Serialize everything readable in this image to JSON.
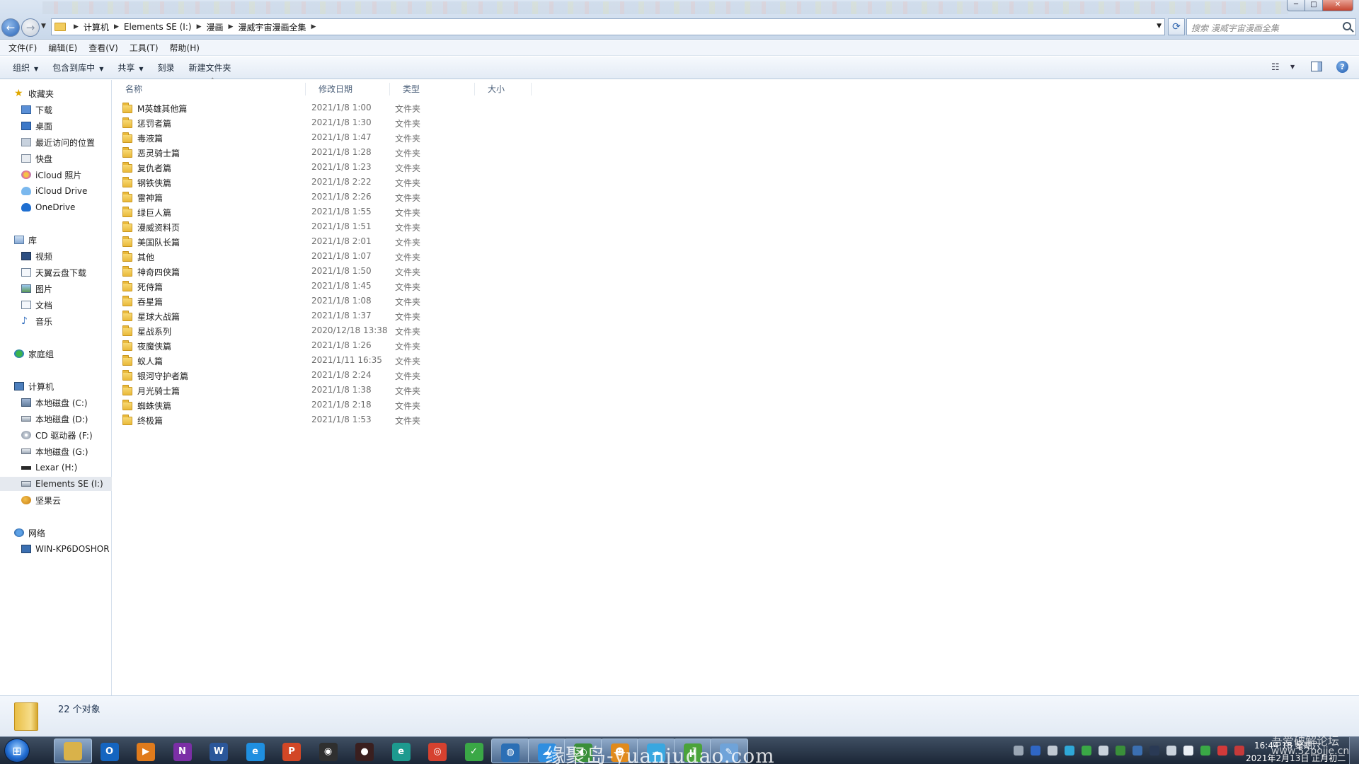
{
  "window": {
    "buttons": {
      "minimize": "─",
      "maximize": "□",
      "close": "✕"
    }
  },
  "address": {
    "crumbs": [
      "计算机",
      "Elements SE (I:)",
      "漫画",
      "漫威宇宙漫画全集"
    ],
    "search_placeholder": "搜索 漫威宇宙漫画全集"
  },
  "menu": [
    "文件(F)",
    "编辑(E)",
    "查看(V)",
    "工具(T)",
    "帮助(H)"
  ],
  "commands": [
    "组织",
    "包含到库中",
    "共享",
    "刻录",
    "新建文件夹"
  ],
  "nav": {
    "favorites": {
      "label": "收藏夹",
      "items": [
        "下载",
        "桌面",
        "最近访问的位置",
        "快盘",
        "iCloud 照片",
        "iCloud Drive",
        "OneDrive"
      ]
    },
    "library": {
      "label": "库",
      "items": [
        "视频",
        "天翼云盘下载",
        "图片",
        "文档",
        "音乐"
      ]
    },
    "homegroup": "家庭组",
    "computer": {
      "label": "计算机",
      "items": [
        "本地磁盘 (C:)",
        "本地磁盘 (D:)",
        "CD 驱动器 (F:)",
        "本地磁盘 (G:)",
        "Lexar (H:)",
        "Elements SE (I:)",
        "坚果云"
      ]
    },
    "network": {
      "label": "网络",
      "items": [
        "WIN-KP6DOSHOR"
      ]
    }
  },
  "columns": {
    "name": "名称",
    "modified": "修改日期",
    "type": "类型",
    "size": "大小"
  },
  "files": [
    {
      "name": "M英雄其他篇",
      "date": "2021/1/8 1:00",
      "type": "文件夹"
    },
    {
      "name": "惩罚者篇",
      "date": "2021/1/8 1:30",
      "type": "文件夹"
    },
    {
      "name": "毒液篇",
      "date": "2021/1/8 1:47",
      "type": "文件夹"
    },
    {
      "name": "恶灵骑士篇",
      "date": "2021/1/8 1:28",
      "type": "文件夹"
    },
    {
      "name": "复仇者篇",
      "date": "2021/1/8 1:23",
      "type": "文件夹"
    },
    {
      "name": "钢铁侠篇",
      "date": "2021/1/8 2:22",
      "type": "文件夹"
    },
    {
      "name": "雷神篇",
      "date": "2021/1/8 2:26",
      "type": "文件夹"
    },
    {
      "name": "绿巨人篇",
      "date": "2021/1/8 1:55",
      "type": "文件夹"
    },
    {
      "name": "漫威资料页",
      "date": "2021/1/8 1:51",
      "type": "文件夹"
    },
    {
      "name": "美国队长篇",
      "date": "2021/1/8 2:01",
      "type": "文件夹"
    },
    {
      "name": "其他",
      "date": "2021/1/8 1:07",
      "type": "文件夹"
    },
    {
      "name": "神奇四侠篇",
      "date": "2021/1/8 1:50",
      "type": "文件夹"
    },
    {
      "name": "死侍篇",
      "date": "2021/1/8 1:45",
      "type": "文件夹"
    },
    {
      "name": "吞星篇",
      "date": "2021/1/8 1:08",
      "type": "文件夹"
    },
    {
      "name": "星球大战篇",
      "date": "2021/1/8 1:37",
      "type": "文件夹"
    },
    {
      "name": "星战系列",
      "date": "2020/12/18 13:38",
      "type": "文件夹"
    },
    {
      "name": "夜魔侠篇",
      "date": "2021/1/8 1:26",
      "type": "文件夹"
    },
    {
      "name": "蚁人篇",
      "date": "2021/1/11 16:35",
      "type": "文件夹"
    },
    {
      "name": "银河守护者篇",
      "date": "2021/1/8 2:24",
      "type": "文件夹"
    },
    {
      "name": "月光骑士篇",
      "date": "2021/1/8 1:38",
      "type": "文件夹"
    },
    {
      "name": "蜘蛛侠篇",
      "date": "2021/1/8 2:18",
      "type": "文件夹"
    },
    {
      "name": "终极篇",
      "date": "2021/1/8 1:53",
      "type": "文件夹"
    }
  ],
  "status": {
    "count": "22 个对象"
  },
  "taskbar": {
    "apps": [
      {
        "icon": "explorer-icon",
        "glyph": "",
        "color": "#d9b24a",
        "active": true
      },
      {
        "icon": "outlook-icon",
        "glyph": "O",
        "color": "#1565c0",
        "active": false
      },
      {
        "icon": "media-player-icon",
        "glyph": "▶",
        "color": "#e07b1c",
        "active": false
      },
      {
        "icon": "onenote-icon",
        "glyph": "N",
        "color": "#7b2fa6",
        "active": false
      },
      {
        "icon": "word-icon",
        "glyph": "W",
        "color": "#2b579a",
        "active": false
      },
      {
        "icon": "ie-icon",
        "glyph": "e",
        "color": "#1f8fe0",
        "active": false
      },
      {
        "icon": "powerpoint-icon",
        "glyph": "P",
        "color": "#d24726",
        "active": false
      },
      {
        "icon": "nvidia-icon",
        "glyph": "◉",
        "color": "#2f2f2f",
        "active": false
      },
      {
        "icon": "obs-icon",
        "glyph": "●",
        "color": "#3a1f1f",
        "active": false
      },
      {
        "icon": "edge-beta-icon",
        "glyph": "e",
        "color": "#1d9a8f",
        "active": false
      },
      {
        "icon": "chrome-icon",
        "glyph": "◎",
        "color": "#d6412f",
        "active": false
      },
      {
        "icon": "green-app-icon",
        "glyph": "✓",
        "color": "#3aa846",
        "active": false
      },
      {
        "icon": "globe-app-icon",
        "glyph": "◍",
        "color": "#2b6fb5",
        "active": true
      },
      {
        "icon": "baidu-netdisk-icon",
        "glyph": "☁",
        "color": "#2f8ee0",
        "active": true
      },
      {
        "icon": "earth-app-icon",
        "glyph": "◐",
        "color": "#3a8f3a",
        "active": true
      },
      {
        "icon": "orange-app-icon",
        "glyph": "☻",
        "color": "#e08a1c",
        "active": true
      },
      {
        "icon": "tianyi-cloud-icon",
        "glyph": "☁",
        "color": "#39a7e0",
        "active": true
      },
      {
        "icon": "utorrent-icon",
        "glyph": "µ",
        "color": "#4aa33a",
        "active": true
      },
      {
        "icon": "notepad-icon",
        "glyph": "✎",
        "color": "#6fa3d9",
        "active": true
      }
    ],
    "clock": {
      "time": "16:44:18 星期六",
      "date": "2021年2月13日 正月初二"
    }
  },
  "watermarks": {
    "center": "缘聚岛-yuanjudao.com",
    "corner": "吾爱破解论坛",
    "url": "www.52pojie.cn"
  }
}
